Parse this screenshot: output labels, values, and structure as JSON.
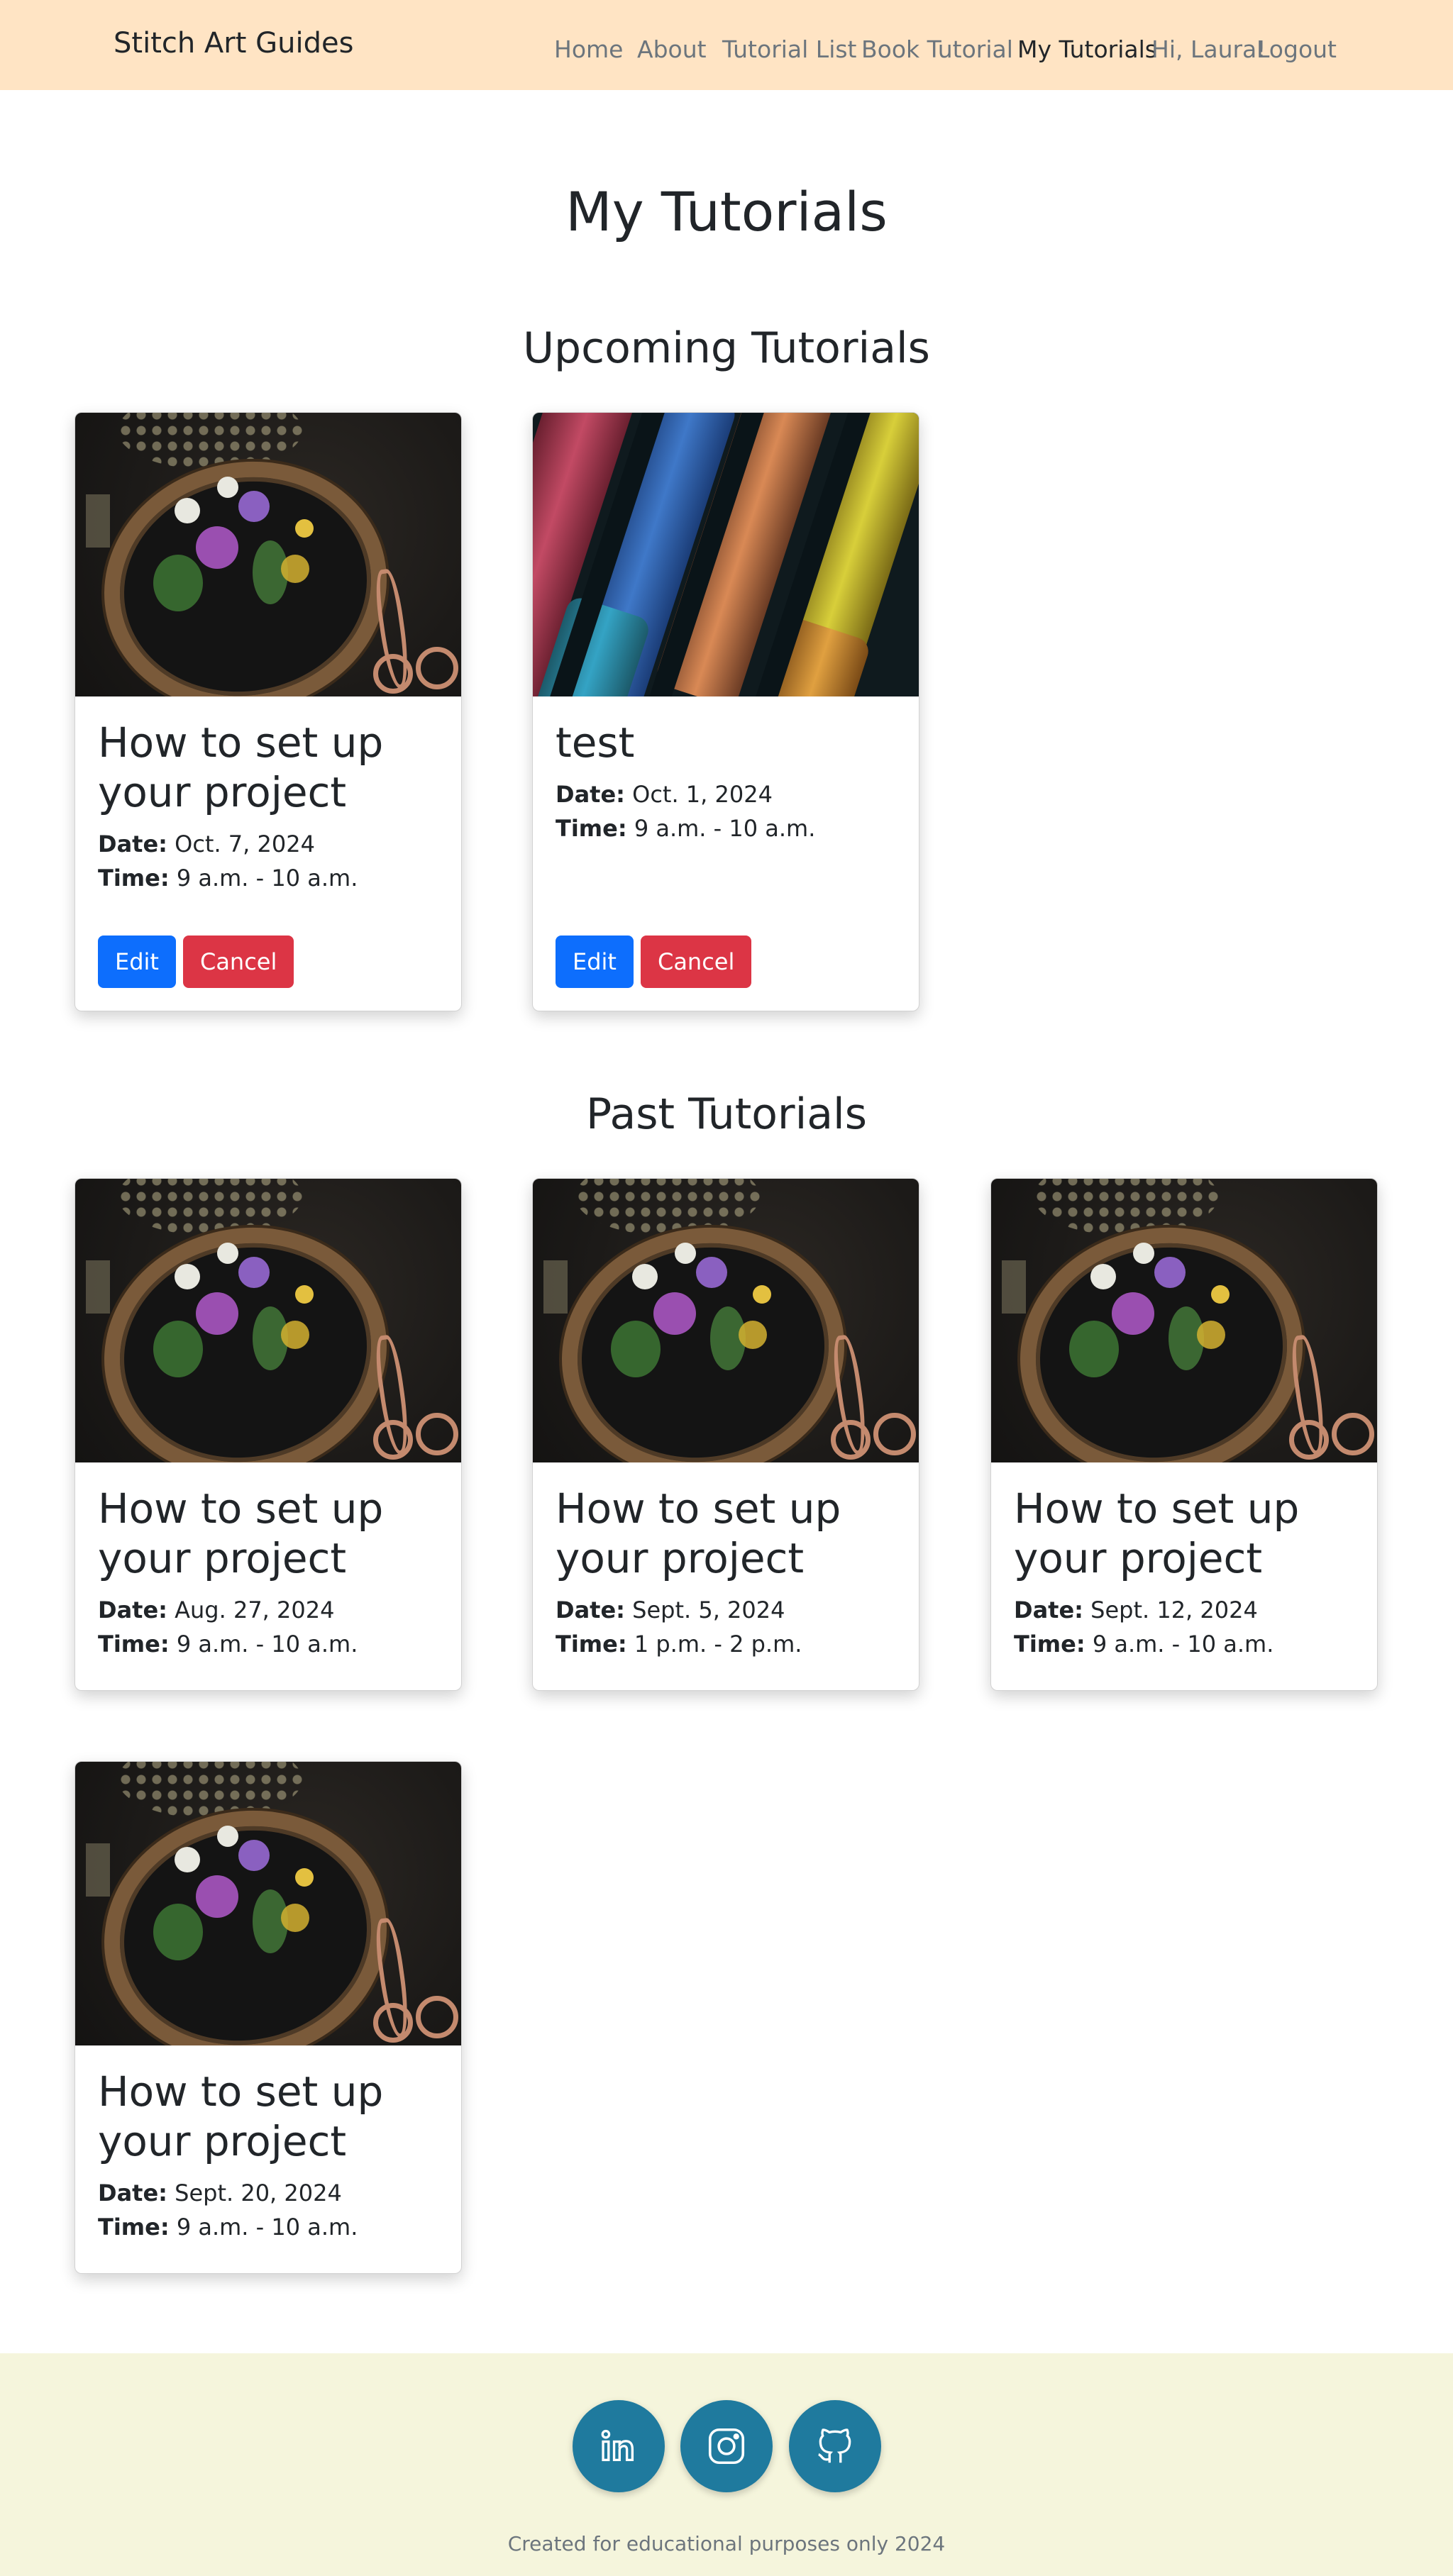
{
  "nav": {
    "brand": "Stitch Art Guides",
    "links": [
      "Home",
      "About",
      "Tutorial List",
      "Book Tutorial",
      "My Tutorials"
    ],
    "active": "My Tutorials",
    "greeting": "Hi, Laura!",
    "logout": "Logout"
  },
  "page": {
    "title": "My Tutorials",
    "upcoming_heading": "Upcoming Tutorials",
    "past_heading": "Past Tutorials"
  },
  "labels": {
    "date": "Date:",
    "time": "Time:",
    "edit": "Edit",
    "cancel": "Cancel"
  },
  "upcoming": [
    {
      "title": "How to set up your project",
      "date": "Oct. 7, 2024",
      "time": "9 a.m. - 10 a.m.",
      "image": "embroidery-hoop-image"
    },
    {
      "title": "test",
      "date": "Oct. 1, 2024",
      "time": "9 a.m. - 10 a.m.",
      "image": "thread-spools-image"
    }
  ],
  "past": [
    {
      "title": "How to set up your project",
      "date": "Aug. 27, 2024",
      "time": "9 a.m. - 10 a.m.",
      "image": "embroidery-hoop-image"
    },
    {
      "title": "How to set up your project",
      "date": "Sept. 5, 2024",
      "time": "1 p.m. - 2 p.m.",
      "image": "embroidery-hoop-image"
    },
    {
      "title": "How to set up your project",
      "date": "Sept. 12, 2024",
      "time": "9 a.m. - 10 a.m.",
      "image": "embroidery-hoop-image"
    },
    {
      "title": "How to set up your project",
      "date": "Sept. 20, 2024",
      "time": "9 a.m. - 10 a.m.",
      "image": "embroidery-hoop-image"
    }
  ],
  "footer": {
    "social": [
      "linkedin-icon",
      "instagram-icon",
      "github-icon"
    ],
    "text": "Created for educational purposes only 2024"
  },
  "colors": {
    "navbar_bg": "#ffe4c4",
    "footer_bg": "#f5f5dc",
    "edit_button": "#0d6efd",
    "cancel_button": "#dc3545",
    "social_circle": "#1f7a9e"
  }
}
